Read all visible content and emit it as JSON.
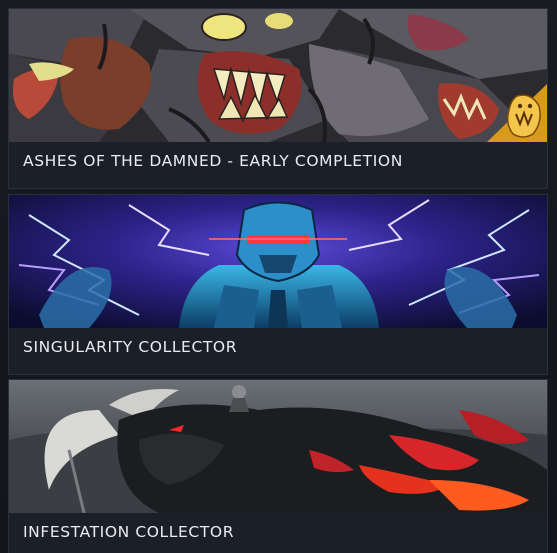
{
  "cards": [
    {
      "title": "ASHES OF THE DAMNED - EARLY COMPLETION",
      "art": "demon-horde-art",
      "badge": "gold-demon-badge-icon"
    },
    {
      "title": "SINGULARITY COLLECTOR",
      "art": "lightning-robot-art"
    },
    {
      "title": "INFESTATION COLLECTOR",
      "art": "horned-beast-art"
    }
  ]
}
